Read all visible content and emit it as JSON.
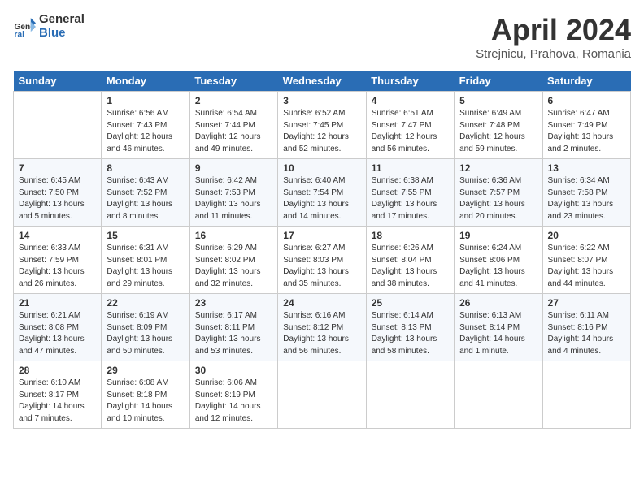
{
  "header": {
    "logo_general": "General",
    "logo_blue": "Blue",
    "title": "April 2024",
    "location": "Strejnicu, Prahova, Romania"
  },
  "days_of_week": [
    "Sunday",
    "Monday",
    "Tuesday",
    "Wednesday",
    "Thursday",
    "Friday",
    "Saturday"
  ],
  "weeks": [
    [
      {
        "day": "",
        "info": ""
      },
      {
        "day": "1",
        "info": "Sunrise: 6:56 AM\nSunset: 7:43 PM\nDaylight: 12 hours\nand 46 minutes."
      },
      {
        "day": "2",
        "info": "Sunrise: 6:54 AM\nSunset: 7:44 PM\nDaylight: 12 hours\nand 49 minutes."
      },
      {
        "day": "3",
        "info": "Sunrise: 6:52 AM\nSunset: 7:45 PM\nDaylight: 12 hours\nand 52 minutes."
      },
      {
        "day": "4",
        "info": "Sunrise: 6:51 AM\nSunset: 7:47 PM\nDaylight: 12 hours\nand 56 minutes."
      },
      {
        "day": "5",
        "info": "Sunrise: 6:49 AM\nSunset: 7:48 PM\nDaylight: 12 hours\nand 59 minutes."
      },
      {
        "day": "6",
        "info": "Sunrise: 6:47 AM\nSunset: 7:49 PM\nDaylight: 13 hours\nand 2 minutes."
      }
    ],
    [
      {
        "day": "7",
        "info": "Sunrise: 6:45 AM\nSunset: 7:50 PM\nDaylight: 13 hours\nand 5 minutes."
      },
      {
        "day": "8",
        "info": "Sunrise: 6:43 AM\nSunset: 7:52 PM\nDaylight: 13 hours\nand 8 minutes."
      },
      {
        "day": "9",
        "info": "Sunrise: 6:42 AM\nSunset: 7:53 PM\nDaylight: 13 hours\nand 11 minutes."
      },
      {
        "day": "10",
        "info": "Sunrise: 6:40 AM\nSunset: 7:54 PM\nDaylight: 13 hours\nand 14 minutes."
      },
      {
        "day": "11",
        "info": "Sunrise: 6:38 AM\nSunset: 7:55 PM\nDaylight: 13 hours\nand 17 minutes."
      },
      {
        "day": "12",
        "info": "Sunrise: 6:36 AM\nSunset: 7:57 PM\nDaylight: 13 hours\nand 20 minutes."
      },
      {
        "day": "13",
        "info": "Sunrise: 6:34 AM\nSunset: 7:58 PM\nDaylight: 13 hours\nand 23 minutes."
      }
    ],
    [
      {
        "day": "14",
        "info": "Sunrise: 6:33 AM\nSunset: 7:59 PM\nDaylight: 13 hours\nand 26 minutes."
      },
      {
        "day": "15",
        "info": "Sunrise: 6:31 AM\nSunset: 8:01 PM\nDaylight: 13 hours\nand 29 minutes."
      },
      {
        "day": "16",
        "info": "Sunrise: 6:29 AM\nSunset: 8:02 PM\nDaylight: 13 hours\nand 32 minutes."
      },
      {
        "day": "17",
        "info": "Sunrise: 6:27 AM\nSunset: 8:03 PM\nDaylight: 13 hours\nand 35 minutes."
      },
      {
        "day": "18",
        "info": "Sunrise: 6:26 AM\nSunset: 8:04 PM\nDaylight: 13 hours\nand 38 minutes."
      },
      {
        "day": "19",
        "info": "Sunrise: 6:24 AM\nSunset: 8:06 PM\nDaylight: 13 hours\nand 41 minutes."
      },
      {
        "day": "20",
        "info": "Sunrise: 6:22 AM\nSunset: 8:07 PM\nDaylight: 13 hours\nand 44 minutes."
      }
    ],
    [
      {
        "day": "21",
        "info": "Sunrise: 6:21 AM\nSunset: 8:08 PM\nDaylight: 13 hours\nand 47 minutes."
      },
      {
        "day": "22",
        "info": "Sunrise: 6:19 AM\nSunset: 8:09 PM\nDaylight: 13 hours\nand 50 minutes."
      },
      {
        "day": "23",
        "info": "Sunrise: 6:17 AM\nSunset: 8:11 PM\nDaylight: 13 hours\nand 53 minutes."
      },
      {
        "day": "24",
        "info": "Sunrise: 6:16 AM\nSunset: 8:12 PM\nDaylight: 13 hours\nand 56 minutes."
      },
      {
        "day": "25",
        "info": "Sunrise: 6:14 AM\nSunset: 8:13 PM\nDaylight: 13 hours\nand 58 minutes."
      },
      {
        "day": "26",
        "info": "Sunrise: 6:13 AM\nSunset: 8:14 PM\nDaylight: 14 hours\nand 1 minute."
      },
      {
        "day": "27",
        "info": "Sunrise: 6:11 AM\nSunset: 8:16 PM\nDaylight: 14 hours\nand 4 minutes."
      }
    ],
    [
      {
        "day": "28",
        "info": "Sunrise: 6:10 AM\nSunset: 8:17 PM\nDaylight: 14 hours\nand 7 minutes."
      },
      {
        "day": "29",
        "info": "Sunrise: 6:08 AM\nSunset: 8:18 PM\nDaylight: 14 hours\nand 10 minutes."
      },
      {
        "day": "30",
        "info": "Sunrise: 6:06 AM\nSunset: 8:19 PM\nDaylight: 14 hours\nand 12 minutes."
      },
      {
        "day": "",
        "info": ""
      },
      {
        "day": "",
        "info": ""
      },
      {
        "day": "",
        "info": ""
      },
      {
        "day": "",
        "info": ""
      }
    ]
  ]
}
